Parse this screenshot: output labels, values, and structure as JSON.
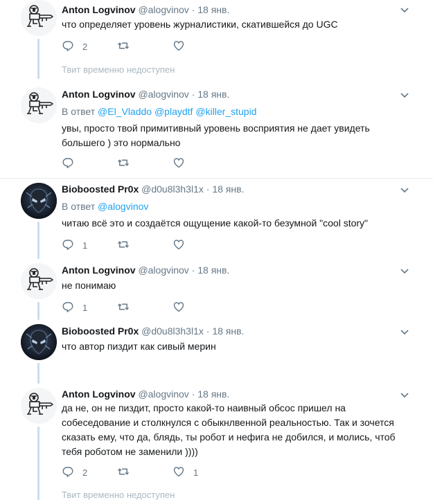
{
  "tweets": [
    {
      "name": "Anton Logvinov",
      "handle": "@alogvinov",
      "date": "18 янв.",
      "reply_prefix": "",
      "reply_users": [],
      "text": "что определяет уровень журналистики, скатившейся до UGC",
      "replies": "2",
      "retweets": "",
      "likes": ""
    },
    {
      "name": "Anton Logvinov",
      "handle": "@alogvinov",
      "date": "18 янв.",
      "reply_prefix": "В ответ",
      "reply_users": [
        "@El_Vladdo",
        "@playdtf",
        "@killer_stupid"
      ],
      "text": "увы, просто твой примитивный уровень восприятия не дает увидеть большего ) это нормально",
      "replies": "",
      "retweets": "",
      "likes": ""
    },
    {
      "name": "Bioboosted Pr0x",
      "handle": "@d0u8l3h3l1x",
      "date": "18 янв.",
      "reply_prefix": "В ответ",
      "reply_users": [
        "@alogvinov"
      ],
      "text": "читаю всё это и создаётся ощущение какой-то безумной \"cool story\"",
      "replies": "1",
      "retweets": "",
      "likes": ""
    },
    {
      "name": "Anton Logvinov",
      "handle": "@alogvinov",
      "date": "18 янв.",
      "reply_prefix": "",
      "reply_users": [],
      "text": "не понимаю",
      "replies": "1",
      "retweets": "",
      "likes": ""
    },
    {
      "name": "Bioboosted Pr0x",
      "handle": "@d0u8l3h3l1x",
      "date": "18 янв.",
      "reply_prefix": "",
      "reply_users": [],
      "text": "что автор пиздит как сивый мерин",
      "replies": "",
      "retweets": "",
      "likes": ""
    },
    {
      "name": "Anton Logvinov",
      "handle": "@alogvinov",
      "date": "18 янв.",
      "reply_prefix": "",
      "reply_users": [],
      "text": "да не, он не пиздит, просто какой-то наивный обсос пришел на собеседование и столкнулся с обыкнлвенной реальностью. Так и зочется сказать ему, что да, блядь, ты робот и нефига не добился, и молись, чтоб тебя роботом не заменили ))))",
      "replies": "2",
      "retweets": "",
      "likes": "1"
    }
  ],
  "unavailable_text": "Твит временно недоступен",
  "separator": "·",
  "icons": {
    "reply": "reply-icon",
    "retweet": "retweet-icon",
    "like": "heart-icon",
    "more": "chevron-down-icon"
  },
  "colors": {
    "link": "#1da1f2",
    "muted": "#657786",
    "thread": "#c8ddf0",
    "border": "#e6ecf0"
  }
}
